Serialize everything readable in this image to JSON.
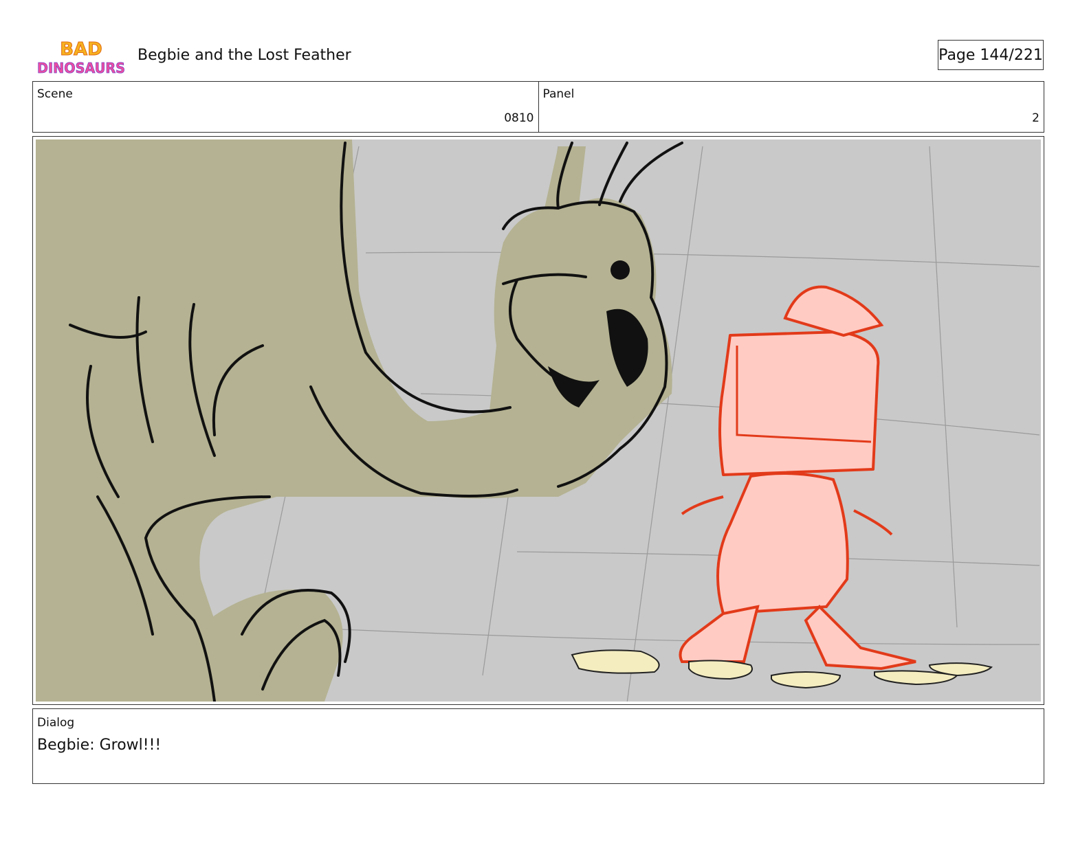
{
  "header": {
    "logo_text_top": "BAD",
    "logo_text_bottom": "DINOSAURS",
    "title": "Begbie and the Lost Feather",
    "page_label": "Page 144/221"
  },
  "info": {
    "scene_label": "Scene",
    "scene_value": "0810",
    "panel_label": "Panel",
    "panel_value": "2"
  },
  "panel": {
    "background_color": "#c9c9c9",
    "big_dino_color": "#b4b292",
    "small_dino_color": "#ffcbc3",
    "small_dino_line_color": "#e23a1a",
    "feather_color": "#f4edc0"
  },
  "dialog": {
    "label": "Dialog",
    "text": "Begbie: Growl!!!"
  }
}
